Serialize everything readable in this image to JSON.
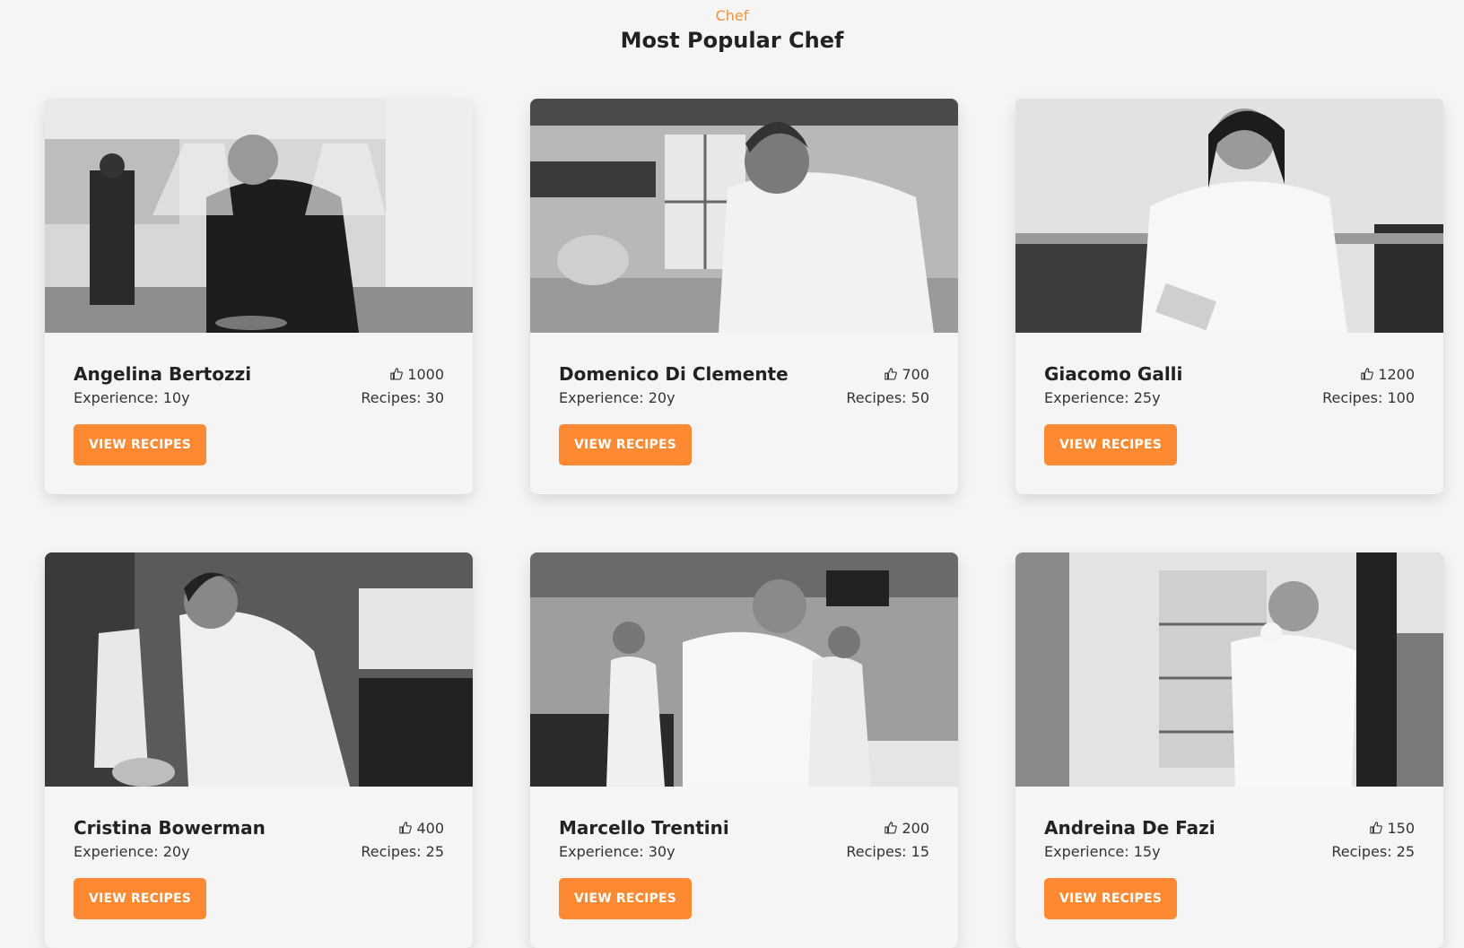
{
  "header": {
    "eyebrow": "Chef",
    "title": "Most Popular Chef"
  },
  "colors": {
    "accent": "#f4913a",
    "button": "#fd8a33",
    "background": "#f5f5f5"
  },
  "button_label": "VIEW RECIPES",
  "chefs": [
    {
      "name": "Angelina Bertozzi",
      "likes": "1000",
      "experience": "Experience: 10y",
      "recipes": "Recipes: 30"
    },
    {
      "name": "Domenico Di Clemente",
      "likes": "700",
      "experience": "Experience: 20y",
      "recipes": "Recipes: 50"
    },
    {
      "name": "Giacomo Galli",
      "likes": "1200",
      "experience": "Experience: 25y",
      "recipes": "Recipes: 100"
    },
    {
      "name": "Cristina Bowerman",
      "likes": "400",
      "experience": "Experience: 20y",
      "recipes": "Recipes: 25"
    },
    {
      "name": "Marcello Trentini",
      "likes": "200",
      "experience": "Experience: 30y",
      "recipes": "Recipes: 15"
    },
    {
      "name": "Andreina De Fazi",
      "likes": "150",
      "experience": "Experience: 15y",
      "recipes": "Recipes: 25"
    }
  ],
  "icons": {
    "likes": "thumbs-up-icon"
  }
}
